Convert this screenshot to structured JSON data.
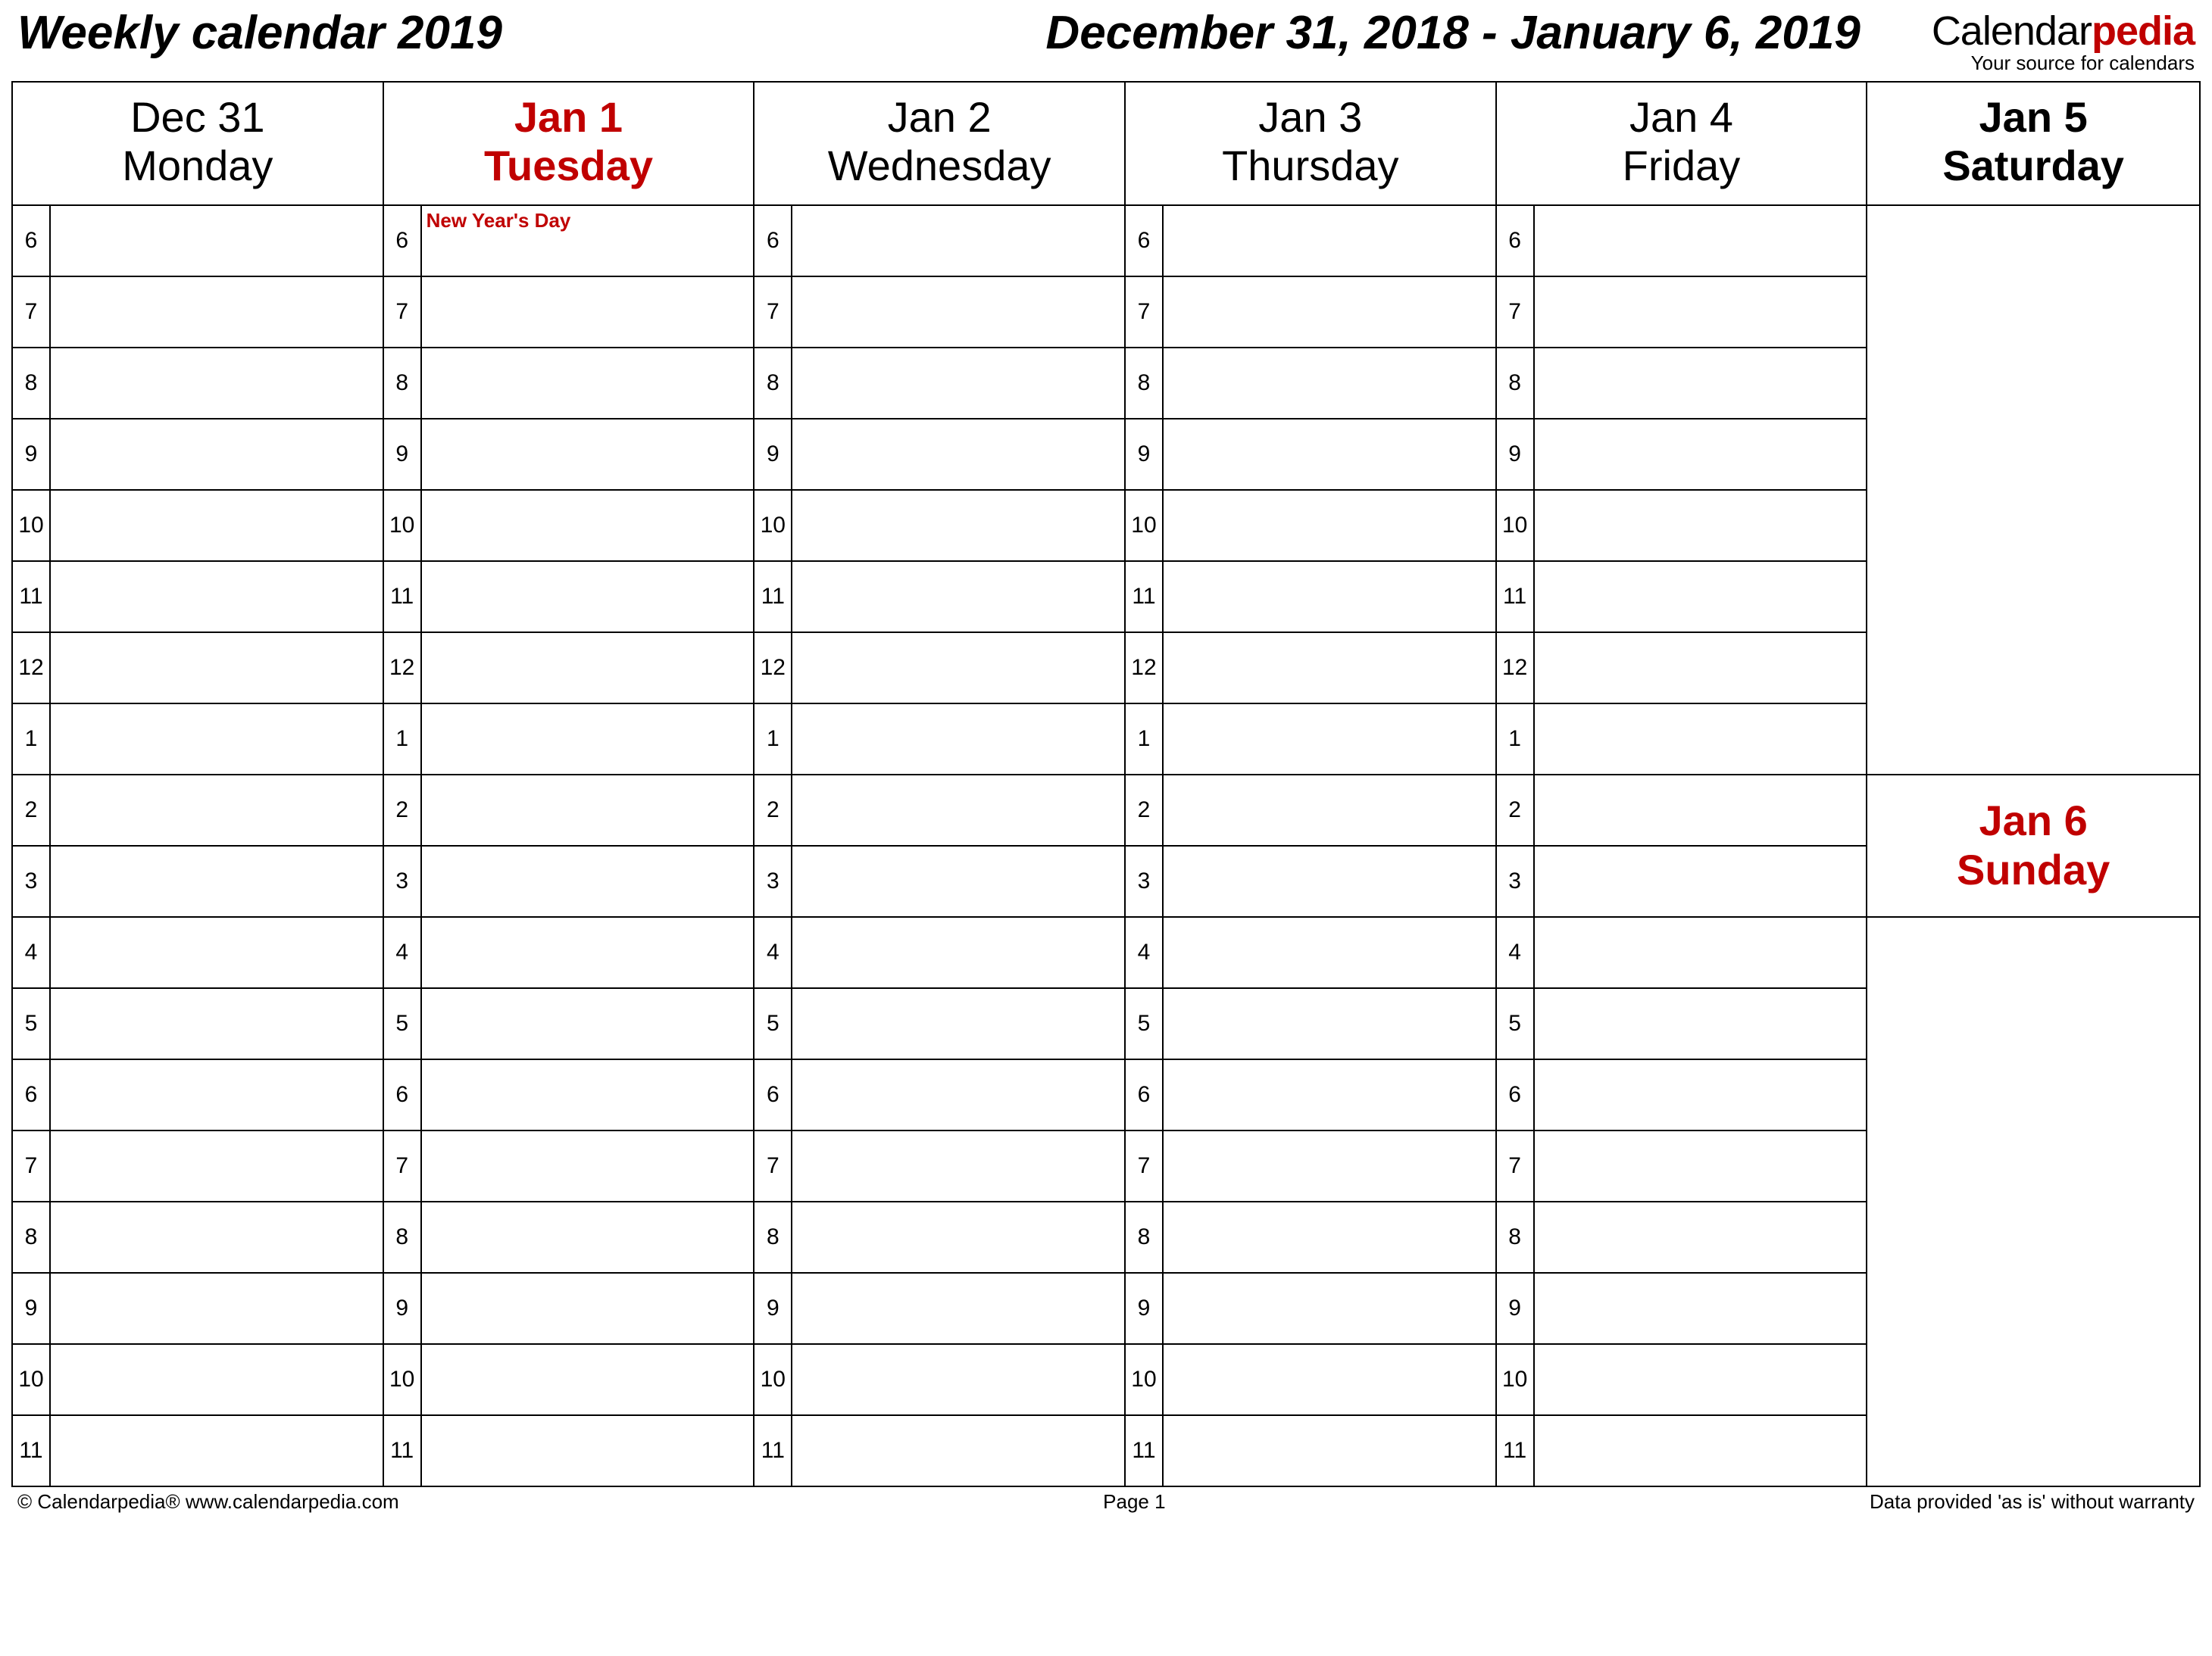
{
  "header": {
    "title_left": "Weekly calendar 2019",
    "title_center": "December 31, 2018 - January 6, 2019",
    "brand_part1": "Calendar",
    "brand_part2": "pedia",
    "brand_tagline": "Your source for calendars"
  },
  "days": [
    {
      "date": "Dec 31",
      "dow": "Monday",
      "holiday": false,
      "note": ""
    },
    {
      "date": "Jan 1",
      "dow": "Tuesday",
      "holiday": true,
      "note": "New Year's Day"
    },
    {
      "date": "Jan 2",
      "dow": "Wednesday",
      "holiday": false,
      "note": ""
    },
    {
      "date": "Jan 3",
      "dow": "Thursday",
      "holiday": false,
      "note": ""
    },
    {
      "date": "Jan 4",
      "dow": "Friday",
      "holiday": false,
      "note": ""
    }
  ],
  "weekend": {
    "sat": {
      "date": "Jan 5",
      "dow": "Saturday"
    },
    "sun": {
      "date": "Jan 6",
      "dow": "Sunday"
    }
  },
  "hours": [
    "6",
    "7",
    "8",
    "9",
    "10",
    "11",
    "12",
    "1",
    "2",
    "3",
    "4",
    "5",
    "6",
    "7",
    "8",
    "9",
    "10",
    "11"
  ],
  "footer": {
    "left": "© Calendarpedia®   www.calendarpedia.com",
    "center": "Page 1",
    "right": "Data provided 'as is' without warranty"
  }
}
